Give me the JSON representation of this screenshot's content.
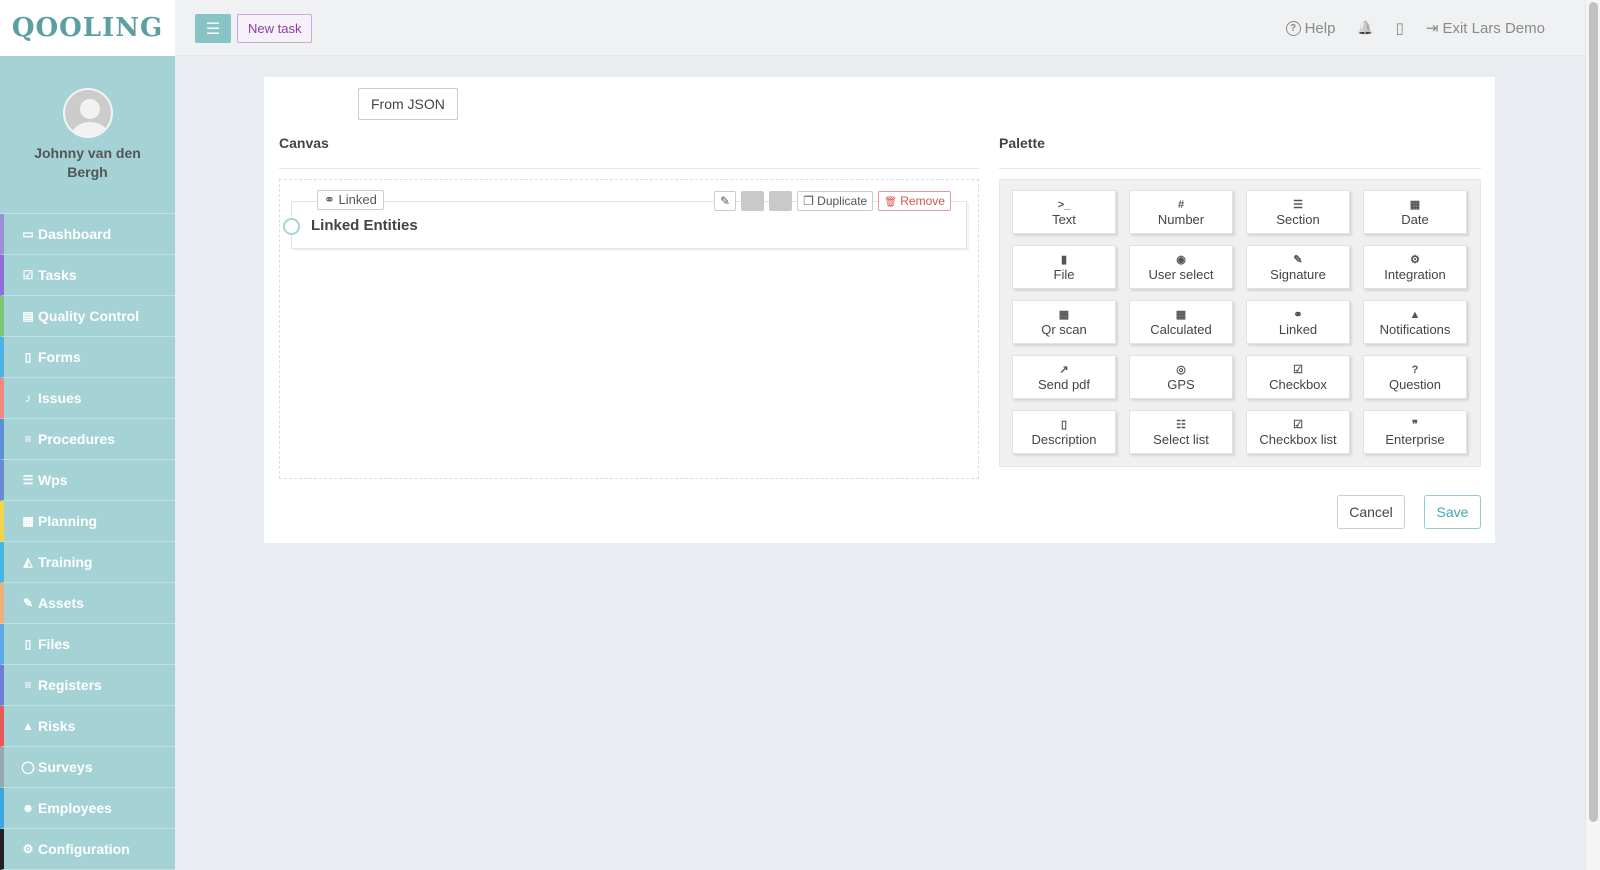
{
  "app": {
    "logo": "QOOLING"
  },
  "user": {
    "name": "Johnny van den Bergh"
  },
  "sidebar": {
    "items": [
      {
        "label": "Dashboard",
        "icon": "monitor-icon",
        "glyph": "▭",
        "accent": "#9b8fd8"
      },
      {
        "label": "Tasks",
        "icon": "check-square-icon",
        "glyph": "☑",
        "accent": "#8b6fd6"
      },
      {
        "label": "Quality Control",
        "icon": "clipboard-icon",
        "glyph": "▤",
        "accent": "#7cc576"
      },
      {
        "label": "Forms",
        "icon": "document-icon",
        "glyph": "▯",
        "accent": "#4fb0e3"
      },
      {
        "label": "Issues",
        "icon": "bell-icon",
        "glyph": "♪",
        "accent": "#f08a7e"
      },
      {
        "label": "Procedures",
        "icon": "list-icon",
        "glyph": "≡",
        "accent": "#5b8fd6"
      },
      {
        "label": "Wps",
        "icon": "sliders-icon",
        "glyph": "☰",
        "accent": "#6a8ad1"
      },
      {
        "label": "Planning",
        "icon": "calendar-icon",
        "glyph": "▦",
        "accent": "#f0d54a"
      },
      {
        "label": "Training",
        "icon": "graduation-cap-icon",
        "glyph": "◭",
        "accent": "#43b6e6"
      },
      {
        "label": "Assets",
        "icon": "wrench-icon",
        "glyph": "✎",
        "accent": "#f0b27a"
      },
      {
        "label": "Files",
        "icon": "file-icon",
        "glyph": "▯",
        "accent": "#5aa9e6"
      },
      {
        "label": "Registers",
        "icon": "lines-icon",
        "glyph": "≡",
        "accent": "#6b7fd7"
      },
      {
        "label": "Risks",
        "icon": "warning-icon",
        "glyph": "▲",
        "accent": "#e8585a"
      },
      {
        "label": "Surveys",
        "icon": "chat-icon",
        "glyph": "◯",
        "accent": "#9aa8b0"
      },
      {
        "label": "Employees",
        "icon": "users-icon",
        "glyph": "☻",
        "accent": "#3aa7e0"
      },
      {
        "label": "Configuration",
        "icon": "gear-icon",
        "glyph": "⚙",
        "accent": "#222222"
      }
    ]
  },
  "topbar": {
    "menu_glyph": "☰",
    "new_task": "New task",
    "help": "Help",
    "help_glyph": "?",
    "bell_glyph": "🔔",
    "building_glyph": "▯",
    "exit_glyph": "⇥",
    "exit": "Exit Lars Demo"
  },
  "builder": {
    "from_json": "From JSON",
    "canvas_title": "Canvas",
    "palette_title": "Palette",
    "field": {
      "tag_glyph": "⚭",
      "tag": "Linked",
      "label": "Linked Entities",
      "wrench_glyph": "✎",
      "duplicate_glyph": "❐",
      "duplicate": "Duplicate",
      "remove_glyph": "🗑",
      "remove": "Remove"
    },
    "palette": [
      {
        "label": "Text",
        "icon": "terminal-icon",
        "glyph": ">_"
      },
      {
        "label": "Number",
        "icon": "hash-icon",
        "glyph": "#"
      },
      {
        "label": "Section",
        "icon": "indent-icon",
        "glyph": "☰"
      },
      {
        "label": "Date",
        "icon": "calendar-icon",
        "glyph": "▦"
      },
      {
        "label": "File",
        "icon": "file-icon",
        "glyph": "▮"
      },
      {
        "label": "User select",
        "icon": "user-circle-icon",
        "glyph": "◉"
      },
      {
        "label": "Signature",
        "icon": "pen-square-icon",
        "glyph": "✎"
      },
      {
        "label": "Integration",
        "icon": "gears-icon",
        "glyph": "⚙"
      },
      {
        "label": "Qr scan",
        "icon": "qrcode-icon",
        "glyph": "▩"
      },
      {
        "label": "Calculated",
        "icon": "calculator-icon",
        "glyph": "▦"
      },
      {
        "label": "Linked",
        "icon": "link-icon",
        "glyph": "⚭"
      },
      {
        "label": "Notifications",
        "icon": "bell-icon",
        "glyph": "▲"
      },
      {
        "label": "Send pdf",
        "icon": "share-square-icon",
        "glyph": "↗"
      },
      {
        "label": "GPS",
        "icon": "crosshair-icon",
        "glyph": "◎"
      },
      {
        "label": "Checkbox",
        "icon": "check-square-icon",
        "glyph": "☑"
      },
      {
        "label": "Question",
        "icon": "question-circle-icon",
        "glyph": "?"
      },
      {
        "label": "Description",
        "icon": "document-icon",
        "glyph": "▯"
      },
      {
        "label": "Select list",
        "icon": "list-ol-icon",
        "glyph": "☷"
      },
      {
        "label": "Checkbox list",
        "icon": "check-square-icon",
        "glyph": "☑"
      },
      {
        "label": "Enterprise",
        "icon": "quote-icon",
        "glyph": "❞"
      }
    ],
    "cancel": "Cancel",
    "save": "Save"
  }
}
